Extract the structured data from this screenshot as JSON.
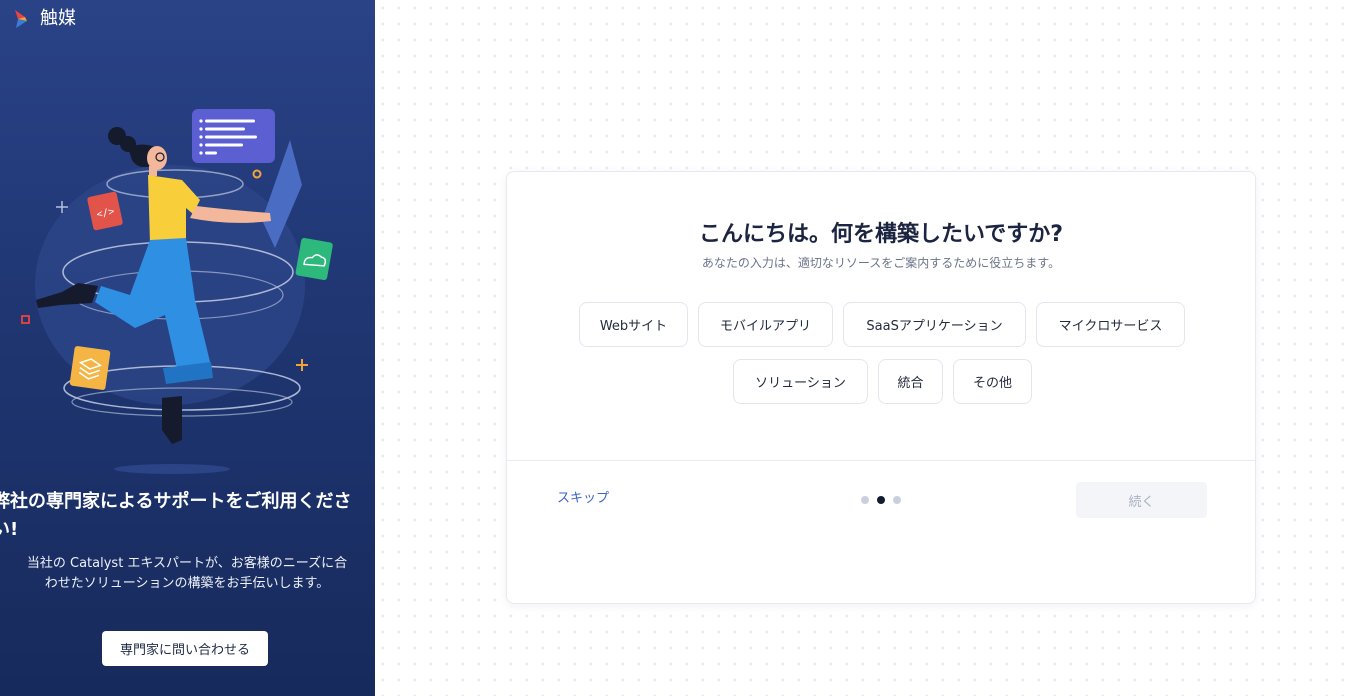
{
  "brand": {
    "name": "触媒",
    "logo_icon": "catalyst-logo-icon"
  },
  "left_panel": {
    "heading": "弊社の専門家によるサポートをご利用ください!",
    "description": "当社の Catalyst エキスパートが、お客様のニーズに合わせたソリューションの構築をお手伝いします。",
    "contact_button": "専門家に問い合わせる",
    "illustration": "developer-illustration"
  },
  "card": {
    "title": "こんにちは。何を構築したいですか?",
    "subtitle": "あなたの入力は、適切なリソースをご案内するために役立ちます。",
    "options": [
      "Webサイト",
      "モバイルアプリ",
      "SaaSアプリケーション",
      "マイクロサービス",
      "ソリューション",
      "統合",
      "その他"
    ],
    "skip_label": "スキップ",
    "continue_label": "続く",
    "progress": {
      "steps": 3,
      "current_step": 2
    }
  },
  "colors": {
    "panel_top": "#2a4387",
    "panel_bottom": "#172a5c",
    "link": "#3c63c8",
    "active_dot": "#141c30",
    "inactive_dot": "#c9cfdc",
    "disabled_button_bg": "#f3f5f9",
    "disabled_button_text": "#aab1c0"
  }
}
